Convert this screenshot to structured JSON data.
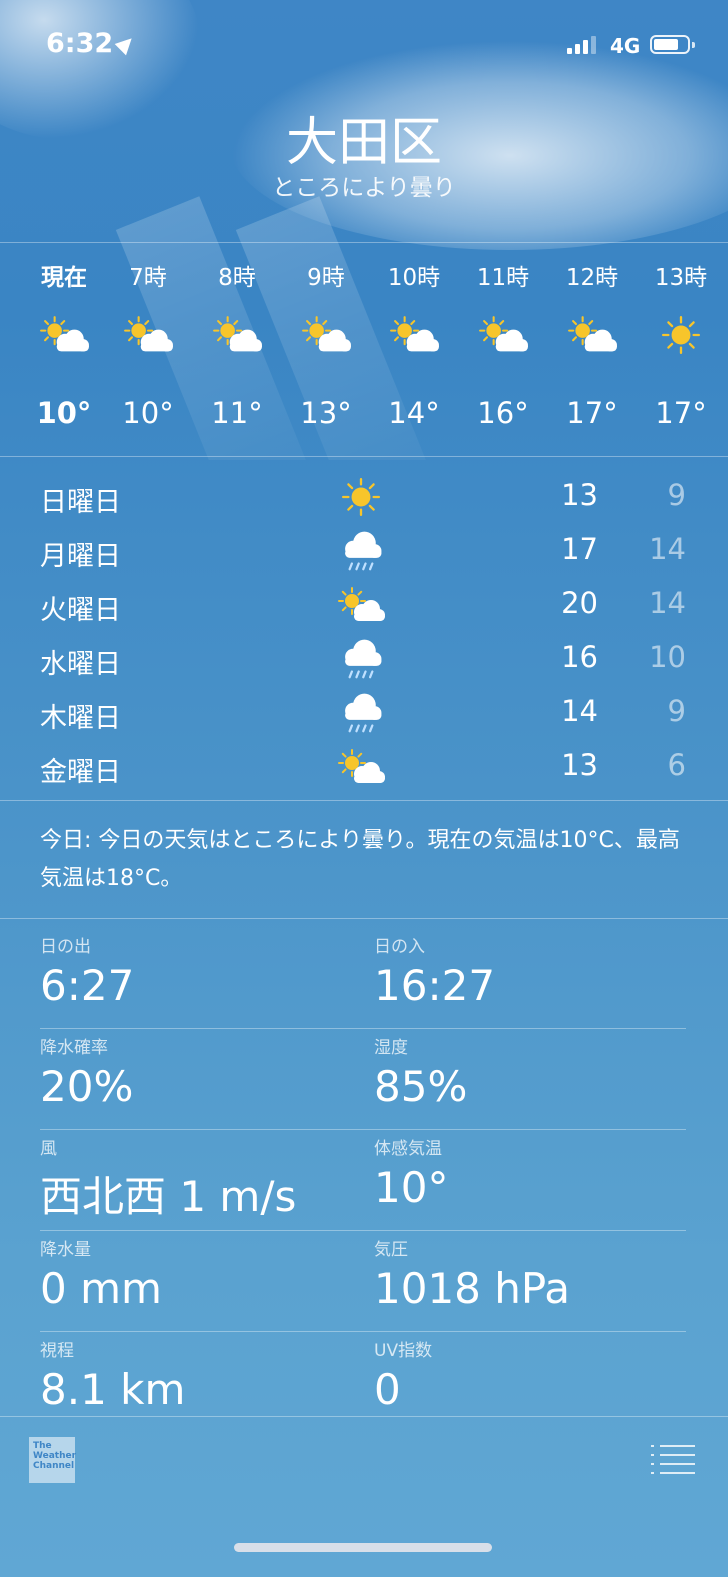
{
  "status": {
    "time": "6:32",
    "network": "4G"
  },
  "location": {
    "city": "大田区",
    "condition": "ところにより曇り"
  },
  "hourly": [
    {
      "label": "現在",
      "icon": "partly-cloudy",
      "temp": "10°"
    },
    {
      "label": "7時",
      "icon": "partly-cloudy",
      "temp": "10°"
    },
    {
      "label": "8時",
      "icon": "partly-cloudy",
      "temp": "11°"
    },
    {
      "label": "9時",
      "icon": "partly-cloudy",
      "temp": "13°"
    },
    {
      "label": "10時",
      "icon": "partly-cloudy",
      "temp": "14°"
    },
    {
      "label": "11時",
      "icon": "partly-cloudy",
      "temp": "16°"
    },
    {
      "label": "12時",
      "icon": "partly-cloudy",
      "temp": "17°"
    },
    {
      "label": "13時",
      "icon": "sun",
      "temp": "17°"
    }
  ],
  "daily": [
    {
      "day": "日曜日",
      "icon": "sun",
      "high": "13",
      "low": "9"
    },
    {
      "day": "月曜日",
      "icon": "rain",
      "high": "17",
      "low": "14"
    },
    {
      "day": "火曜日",
      "icon": "partly-cloudy",
      "high": "20",
      "low": "14"
    },
    {
      "day": "水曜日",
      "icon": "rain",
      "high": "16",
      "low": "10"
    },
    {
      "day": "木曜日",
      "icon": "rain",
      "high": "14",
      "low": "9"
    },
    {
      "day": "金曜日",
      "icon": "partly-cloudy",
      "high": "13",
      "low": "6"
    }
  ],
  "summary": "今日: 今日の天気はところにより曇り。現在の気温は10°C、最高気温は18°C。",
  "details": [
    [
      {
        "label": "日の出",
        "value": "6:27"
      },
      {
        "label": "日の入",
        "value": "16:27"
      }
    ],
    [
      {
        "label": "降水確率",
        "value": "20%"
      },
      {
        "label": "湿度",
        "value": "85%"
      }
    ],
    [
      {
        "label": "風",
        "value": "西北西 1 m/s"
      },
      {
        "label": "体感気温",
        "value": "10°"
      }
    ],
    [
      {
        "label": "降水量",
        "value": "0 mm"
      },
      {
        "label": "気圧",
        "value": "1018 hPa"
      }
    ],
    [
      {
        "label": "視程",
        "value": "8.1 km"
      },
      {
        "label": "UV指数",
        "value": "0"
      }
    ]
  ],
  "footer": {
    "logo_text": "The Weather Channel"
  },
  "colors": {
    "sun": "#f7c52b",
    "cloud": "#ffffff",
    "rain": "#bfe0ff"
  }
}
